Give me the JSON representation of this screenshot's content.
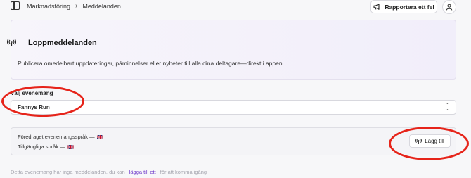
{
  "breadcrumb": {
    "parent": "Marknadsföring",
    "separator": "›",
    "current": "Meddelanden"
  },
  "header": {
    "report_label": "Rapportera ett fel"
  },
  "hero": {
    "title": "Loppmeddelanden",
    "description": "Publicera omedelbart uppdateringar, påminnelser eller nyheter till alla dina deltagare—direkt i appen."
  },
  "event_select": {
    "label": "Välj evenemang",
    "value": "Fannys Run"
  },
  "languages": {
    "preferred_label": "Föredraget evenemangsspråk —",
    "available_label": "Tillgängliga språk —",
    "add_label": "Lägg till"
  },
  "empty_state": {
    "prefix": "Detta evenemang har inga meddelanden, du kan",
    "link": "lägga till ett",
    "suffix": "för att komma igång"
  },
  "colors": {
    "accent": "#6b35c9",
    "annotation": "#e6241a"
  },
  "icons": [
    "sidebar-toggle-icon",
    "megaphone-icon",
    "user-icon",
    "broadcast-icon",
    "uk-flag-icon",
    "chevron-updown-icon"
  ]
}
